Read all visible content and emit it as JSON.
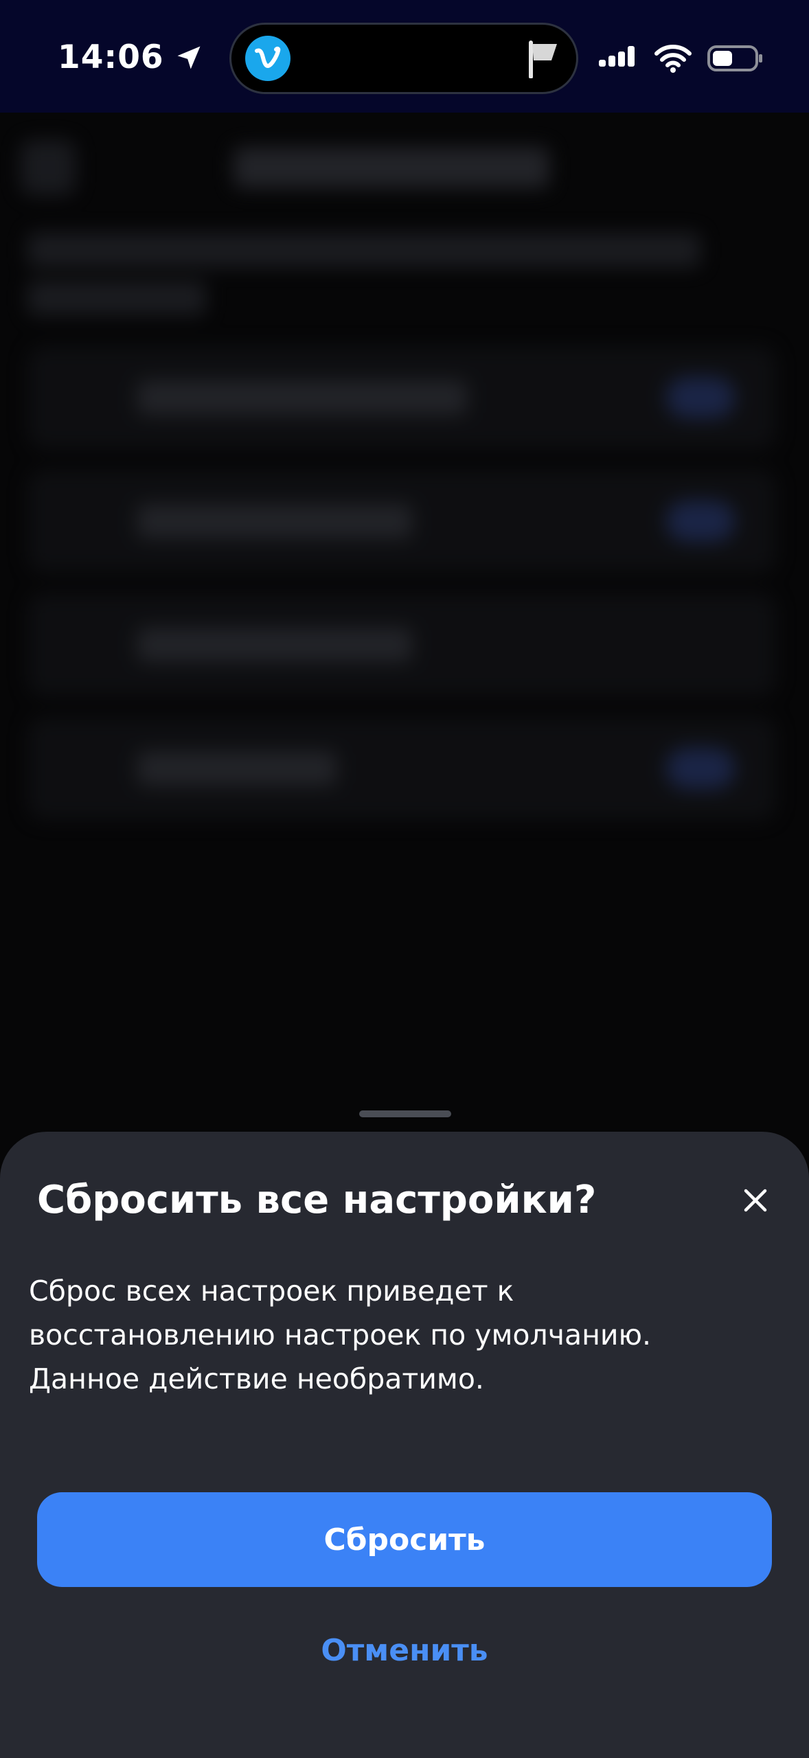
{
  "status_bar": {
    "time": "14:06",
    "icons": [
      "location-arrow-icon",
      "app-icon",
      "flag-icon",
      "signal-icon",
      "wifi-icon",
      "battery-icon"
    ]
  },
  "background": {
    "blurred_rows": 4,
    "toggle_states": [
      true,
      true,
      false,
      true
    ]
  },
  "sheet": {
    "title": "Сбросить все настройки?",
    "body_lines": [
      "Сброс всех настроек приведет к",
      "восстановлению настроек по умолчанию.",
      "Данное действие необратимо."
    ],
    "confirm_label": "Сбросить",
    "cancel_label": "Отменить"
  },
  "colors": {
    "status_bar_bg": "#05062a",
    "sheet_bg": "#272931",
    "accent": "#3b82f6",
    "cancel_text": "#4a8ff5"
  }
}
